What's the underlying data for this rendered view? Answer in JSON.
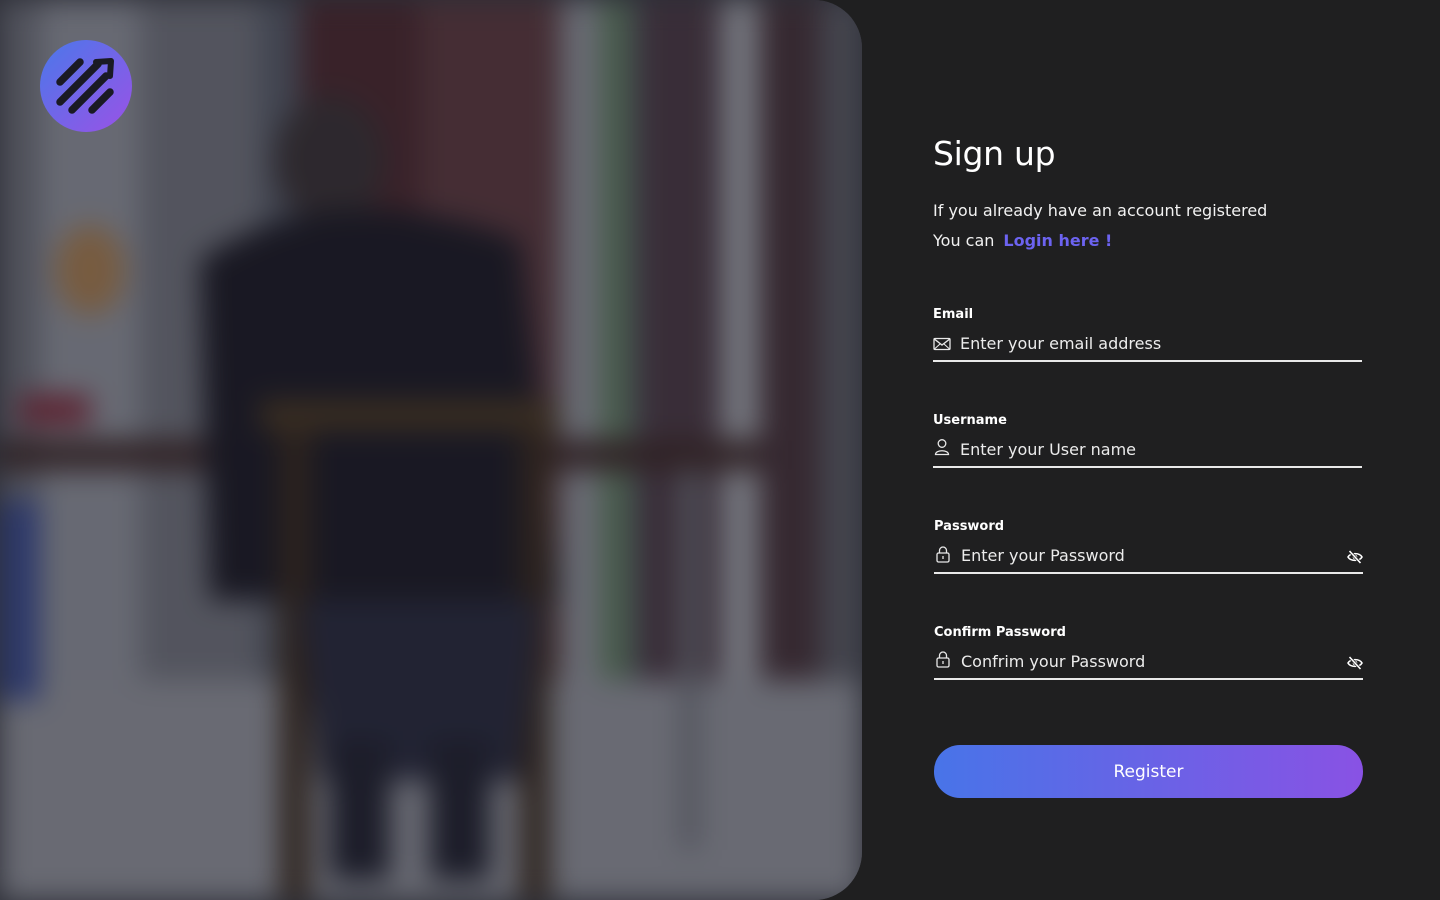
{
  "brand": {
    "logo_icon": "diagonal-stripes-arrow-logo",
    "gradient_start": "#4a78ea",
    "gradient_end": "#9a52e6"
  },
  "signup": {
    "title": "Sign up",
    "subtitle_line1": "If you already have an account registered",
    "subtitle_line2_prefix": "You can",
    "login_link": "Login here !"
  },
  "fields": {
    "email": {
      "label": "Email",
      "placeholder": "Enter your email address",
      "value": "",
      "icon": "envelope-icon"
    },
    "username": {
      "label": "Username",
      "placeholder": "Enter your User name",
      "value": "",
      "icon": "user-icon"
    },
    "password": {
      "label": "Password",
      "placeholder": "Enter your Password",
      "value": "",
      "icon": "lock-icon",
      "toggle_icon": "eye-slash-icon"
    },
    "confirm_password": {
      "label": "Confirm Password",
      "placeholder": "Confrim your Password",
      "value": "",
      "icon": "lock-icon",
      "toggle_icon": "eye-slash-icon"
    }
  },
  "actions": {
    "register_label": "Register"
  },
  "colors": {
    "background": "#1f1f20",
    "accent_link": "#6c63f0",
    "button_gradient_start": "#4874e8",
    "button_gradient_end": "#8952e4",
    "text": "#ffffff"
  }
}
